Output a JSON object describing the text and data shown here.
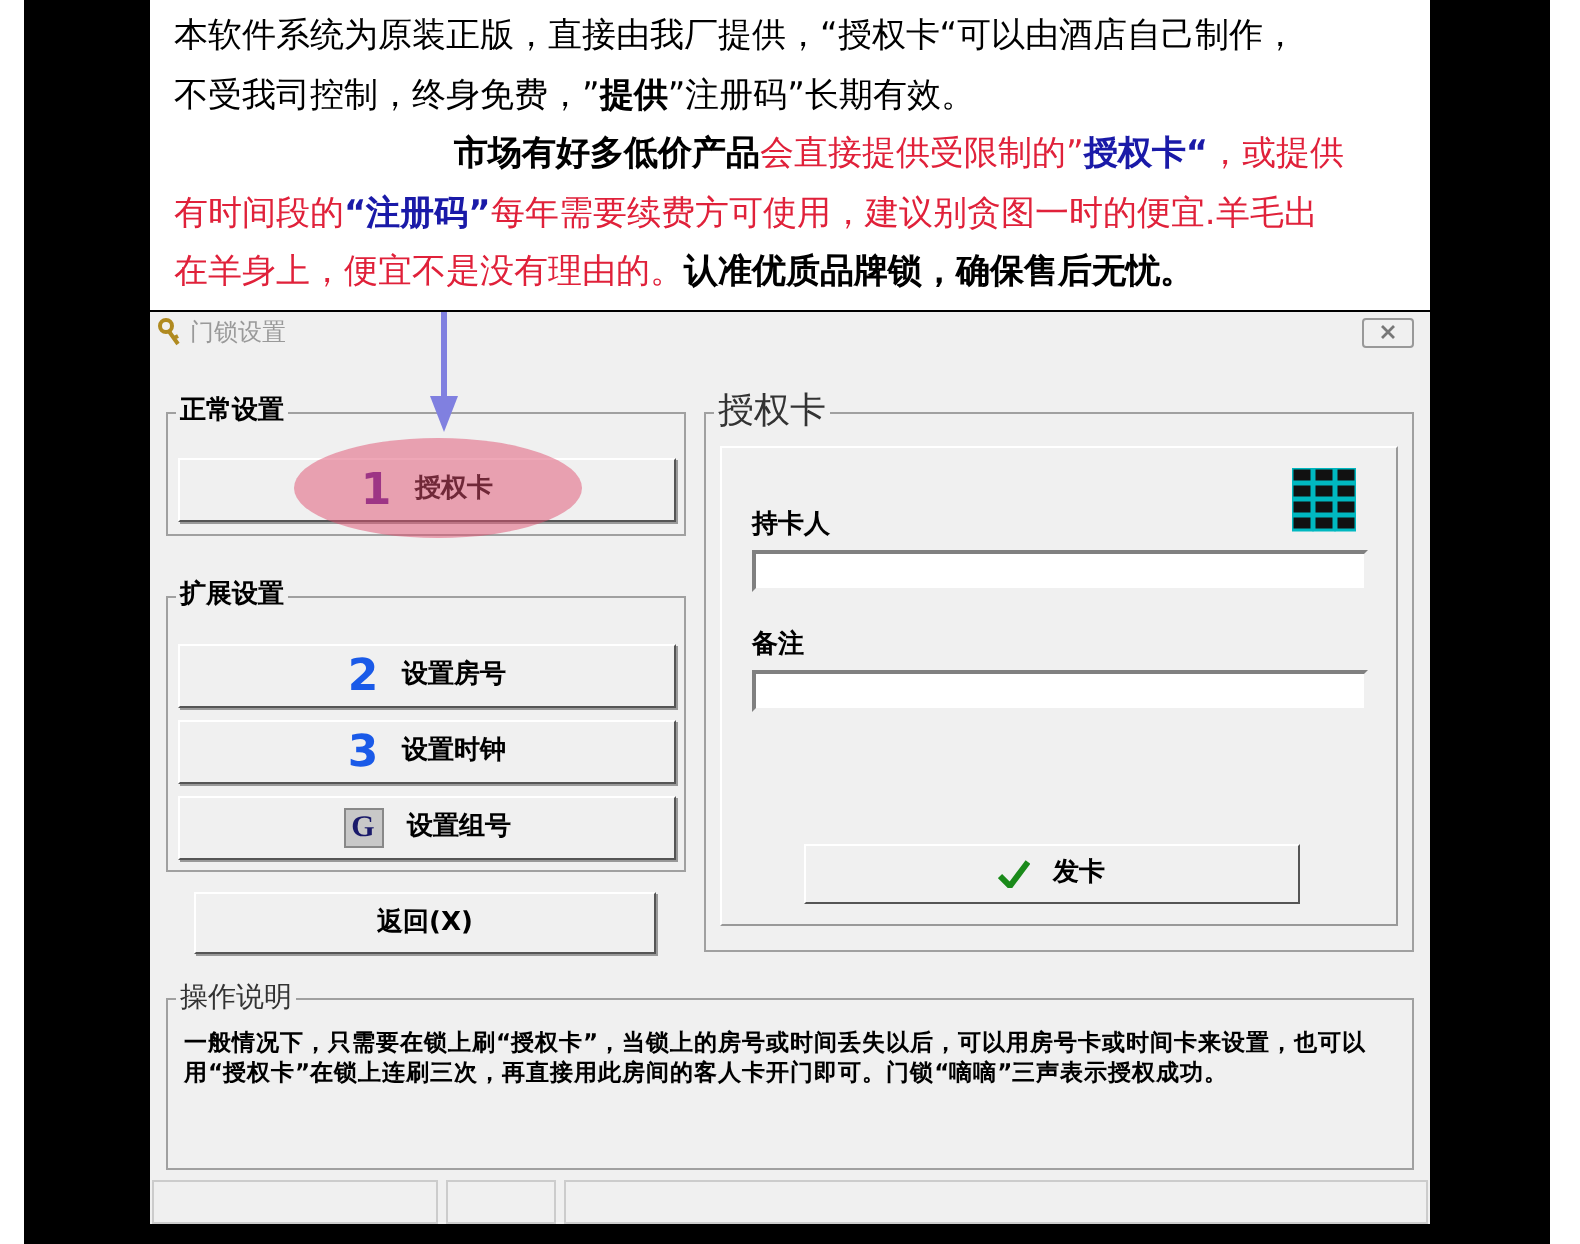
{
  "notice": [
    [
      {
        "text": "本软件系统为原装正版，直接由我厂提供，“授权卡“可以由酒店自己制作，",
        "kind": "plain"
      }
    ],
    [
      {
        "text": "不受我司控制，终身免费，”",
        "kind": "plain"
      },
      {
        "text": "提供",
        "kind": "strong"
      },
      {
        "text": "”注册码”长期有效。",
        "kind": "plain"
      }
    ],
    [
      {
        "text": "市场有好多低价产品",
        "kind": "strong"
      },
      {
        "text": "会直接提供受限制的”",
        "kind": "red"
      },
      {
        "text": "授权卡“",
        "kind": "blue"
      },
      {
        "text": "，或提供",
        "kind": "red"
      }
    ],
    [
      {
        "text": "有时间段的",
        "kind": "red"
      },
      {
        "text": "“注册码”",
        "kind": "blue"
      },
      {
        "text": "每年需要续费方可使用，建议别贪图一时的便宜.羊毛出",
        "kind": "red"
      }
    ],
    [
      {
        "text": "在羊身上，便宜不是没有理由的。",
        "kind": "red"
      },
      {
        "text": "认准优质品牌锁，确保售后无忧。",
        "kind": "strong"
      }
    ]
  ],
  "window": {
    "title": "门锁设置"
  },
  "normal_group": {
    "title": "正常设置",
    "buttons": [
      {
        "badge": "1",
        "label": "授权卡",
        "kind": "violet"
      }
    ]
  },
  "extended_group": {
    "title": "扩展设置",
    "buttons": [
      {
        "badge": "2",
        "label": "设置房号",
        "kind": "blue"
      },
      {
        "badge": "3",
        "label": "设置时钟",
        "kind": "blue"
      },
      {
        "badge": "G",
        "label": "设置组号",
        "kind": "tile"
      }
    ]
  },
  "return_button": {
    "label": "返回(X)"
  },
  "card_group": {
    "title": "授权卡",
    "fields": [
      {
        "label": "持卡人"
      },
      {
        "label": "备注"
      }
    ],
    "issue_button": {
      "label": "发卡"
    }
  },
  "help_group": {
    "title": "操作说明",
    "text": "一般情况下，只需要在锁上刷“授权卡”，当锁上的房号或时间丢失以后，可以用房号卡或时间卡来设置，也可以用“授权卡”在锁上连刷三次，再直接用此房间的客人卡开门即可。门锁“嘀嘀”三声表示授权成功。"
  }
}
